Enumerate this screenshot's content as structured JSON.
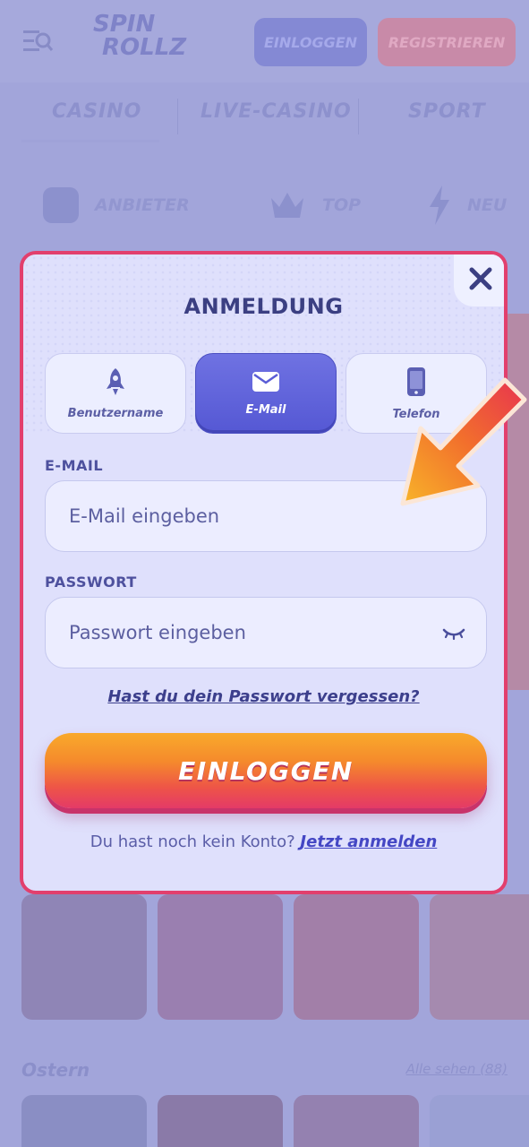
{
  "background": {
    "logo": {
      "line1": "SPIN",
      "line2": "ROLLZ"
    },
    "header": {
      "login_label": "EINLOGGEN",
      "register_label": "REGISTRIEREN"
    },
    "nav_tabs": [
      "CASINO",
      "LIVE-CASINO",
      "SPORT"
    ],
    "chips": [
      "ANBIETER",
      "TOP",
      "NEU"
    ],
    "section": {
      "title": "Ostern",
      "see_all": "Alle sehen (88)"
    }
  },
  "modal": {
    "title": "ANMELDUNG",
    "tabs": [
      {
        "label": "Benutzername",
        "icon": "rocket-icon",
        "active": false
      },
      {
        "label": "E-Mail",
        "icon": "envelope-icon",
        "active": true
      },
      {
        "label": "Telefon",
        "icon": "phone-icon",
        "active": false
      }
    ],
    "email": {
      "label": "E-MAIL",
      "placeholder": "E-Mail eingeben",
      "value": ""
    },
    "password": {
      "label": "PASSWORT",
      "placeholder": "Passwort eingeben",
      "value": ""
    },
    "forgot_link": "Hast du dein Passwort vergessen?",
    "submit_label": "EINLOGGEN",
    "signup_prompt": "Du hast noch kein Konto?",
    "signup_link": "Jetzt anmelden"
  },
  "colors": {
    "modal_border": "#e23f6d",
    "active_tab": "#6063dc",
    "title_text": "#3b3f82",
    "arrow": "#f08a2a"
  }
}
